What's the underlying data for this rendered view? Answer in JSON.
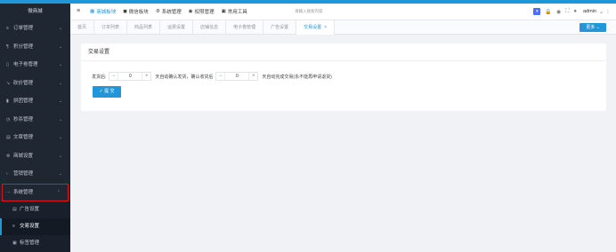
{
  "sidebar": {
    "logo": "微商城",
    "items": [
      {
        "icon": "≡",
        "label": "订单管理"
      },
      {
        "icon": "¶",
        "label": "积分管理"
      },
      {
        "icon": "▯",
        "label": "电子卷管理"
      },
      {
        "icon": "↘",
        "label": "砍价管理"
      },
      {
        "icon": "▮",
        "label": "拼团管理"
      },
      {
        "icon": "◷",
        "label": "秒杀管理"
      },
      {
        "icon": "▤",
        "label": "文章管理"
      },
      {
        "icon": "⚙",
        "label": "商城设置"
      },
      {
        "icon": "‹",
        "label": "营销管理"
      },
      {
        "icon": "⋯",
        "label": "系统管理"
      }
    ],
    "sub_items": [
      {
        "icon": "▤",
        "label": "广告设置"
      },
      {
        "icon": "≡",
        "label": "交易设置"
      },
      {
        "icon": "▣",
        "label": "标签管理"
      }
    ]
  },
  "header": {
    "menu_icon": "≡",
    "nav": [
      {
        "icon": "▦",
        "label": "商城板块"
      },
      {
        "icon": "◼",
        "label": "微信板块"
      },
      {
        "icon": "⚙",
        "label": "系统管理"
      },
      {
        "icon": "◉",
        "label": "权限管理"
      },
      {
        "icon": "▣",
        "label": "常用工具"
      }
    ],
    "search_placeholder": "请输入搜索内容",
    "user": "admin",
    "square_label": "▾",
    "lock": "🔒",
    "eye": "◉",
    "full": "⛶",
    "chev": "⌄"
  },
  "tabs": {
    "items": [
      "首页",
      "订单列表",
      "商品列表",
      "运费设置",
      "店铺信息",
      "电子卷管理",
      "广告设置",
      "交易设置"
    ],
    "close": "×",
    "more": "更多"
  },
  "card": {
    "title": "交易设置",
    "prefix": "发货后:",
    "value1": "0",
    "mid": "天自动确认发货，确认收货后",
    "value2": "0",
    "suffix": "天自动完成交易(永不能再申请退货)",
    "minus": "−",
    "plus": "+",
    "submit": "✓ 提 交"
  }
}
